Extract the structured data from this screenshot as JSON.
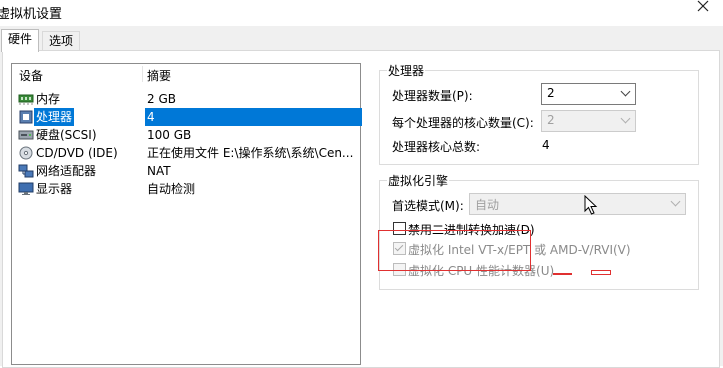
{
  "window": {
    "title": "虚拟机设置"
  },
  "tabs": [
    {
      "label": "硬件",
      "active": true
    },
    {
      "label": "选项",
      "active": false
    }
  ],
  "device_list": {
    "columns": [
      "设备",
      "摘要"
    ],
    "rows": [
      {
        "icon": "memory-icon",
        "device": "内存",
        "summary": "2 GB",
        "selected": false
      },
      {
        "icon": "processor-icon",
        "device": "处理器",
        "summary": "4",
        "selected": true
      },
      {
        "icon": "hard-disk-icon",
        "device": "硬盘(SCSI)",
        "summary": "100 GB",
        "selected": false
      },
      {
        "icon": "cd-dvd-icon",
        "device": "CD/DVD (IDE)",
        "summary": "正在使用文件 E:\\操作系统\\系统\\Cen...",
        "selected": false
      },
      {
        "icon": "network-adapter-icon",
        "device": "网络适配器",
        "summary": "NAT",
        "selected": false
      },
      {
        "icon": "display-icon",
        "device": "显示器",
        "summary": "自动检测",
        "selected": false
      }
    ]
  },
  "processors": {
    "legend": "处理器",
    "count_label": "处理器数量(P):",
    "count_value": "2",
    "cores_label": "每个处理器的核心数量(C):",
    "cores_value": "2",
    "total_label": "处理器核心总数:",
    "total_value": "4"
  },
  "virtualization": {
    "legend": "虚拟化引擎",
    "mode_label": "首选模式(M):",
    "mode_value": "自动",
    "options": [
      {
        "label": "禁用二进制转换加速(D)",
        "checked": false,
        "enabled": true
      },
      {
        "label": "虚拟化 Intel VT-x/EPT 或 AMD-V/RVI(V)",
        "checked": true,
        "enabled": false
      },
      {
        "label": "虚拟化 CPU 性能计数器(U)",
        "checked": false,
        "enabled": false
      }
    ]
  },
  "colors": {
    "selection": "#0078d7",
    "annotation": "#e03030",
    "panel_bg": "#f0f0f0"
  }
}
